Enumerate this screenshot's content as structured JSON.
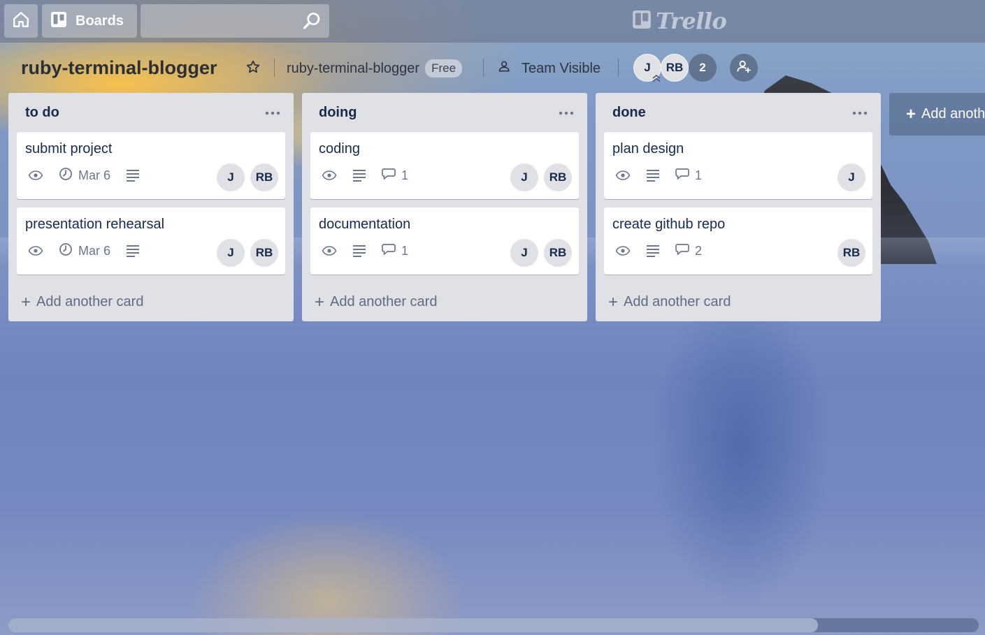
{
  "header": {
    "boards_label": "Boards",
    "search_value": "",
    "logo_text": "Trello"
  },
  "board": {
    "title": "ruby-terminal-blogger",
    "team_name": "ruby-terminal-blogger",
    "plan_badge": "Free",
    "visibility_label": "Team Visible",
    "members": [
      "J",
      "RB"
    ],
    "extra_members_count": "2"
  },
  "lists": [
    {
      "title": "to do",
      "add_card_label": "Add another card",
      "cards": [
        {
          "title": "submit project",
          "due": "Mar 6",
          "members": [
            "J",
            "RB"
          ]
        },
        {
          "title": "presentation rehearsal",
          "due": "Mar 6",
          "members": [
            "J",
            "RB"
          ]
        }
      ]
    },
    {
      "title": "doing",
      "add_card_label": "Add another card",
      "cards": [
        {
          "title": "coding",
          "comments": "1",
          "members": [
            "J",
            "RB"
          ]
        },
        {
          "title": "documentation",
          "comments": "1",
          "members": [
            "J",
            "RB"
          ]
        }
      ]
    },
    {
      "title": "done",
      "add_card_label": "Add another card",
      "cards": [
        {
          "title": "plan design",
          "comments": "1",
          "members": [
            "J"
          ]
        },
        {
          "title": "create github repo",
          "comments": "2",
          "members": [
            "RB"
          ]
        }
      ]
    }
  ],
  "add_list_label": "Add anoth",
  "icons": {
    "home": "home-icon",
    "boards": "boards-icon",
    "search": "search-icon",
    "star": "star-icon",
    "visibility": "team-visibility-icon",
    "invite": "invite-member-icon",
    "watch": "eye-icon",
    "due": "clock-icon",
    "description": "description-icon",
    "comments": "comment-icon",
    "menu": "ellipsis-icon"
  },
  "colors": {
    "list_bg": "#dfe1e6",
    "card_bg": "#ffffff",
    "text": "#172b4d",
    "muted": "#6b778c"
  }
}
